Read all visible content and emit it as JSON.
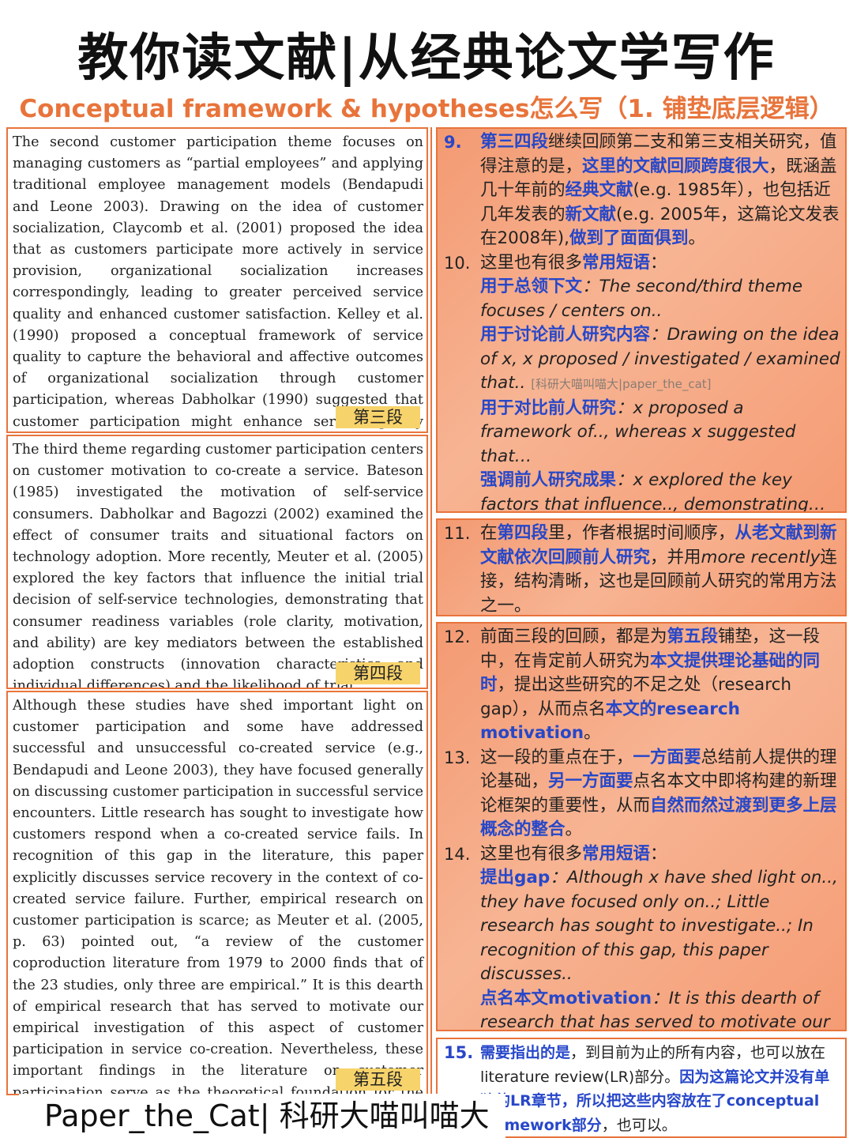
{
  "header": {
    "title": "教你读文献|从经典论文学写作",
    "subtitle": "Conceptual framework & hypotheses怎么写（1. 铺垫底层逻辑）"
  },
  "left": {
    "para3": {
      "text": "The second customer participation theme focuses on managing customers as “partial employees” and applying traditional employee management models (Bendapudi and Leone 2003). Drawing on the idea of customer socialization, Claycomb et al. (2001) proposed the idea that as customers participate more actively in service provision, organizational socialization increases correspondingly, leading to greater perceived service quality and enhanced customer satisfaction. Kelley et al. (1990) proposed a conceptual framework of service quality to capture the behavioral and affective outcomes of organizational socialization through customer participation, whereas Dabholkar (1990) suggested that customer participation might enhance service quality perceptions and satisfaction.",
      "tag": "第三段"
    },
    "para4": {
      "text": "The third theme regarding customer participation centers on customer motivation to co-create a service. Bateson (1985) investigated the motivation of self-service consumers. Dabholkar and Bagozzi (2002) examined the effect of consumer traits and situational factors on technology adoption. More recently, Meuter et al. (2005) explored the key factors that influence the initial trial decision of self-service technologies, demonstrating that consumer readiness variables (role clarity, motivation, and ability) are key mediators between the established adoption constructs (innovation characteristics and individual differences) and the likelihood of trial.",
      "tag": "第四段"
    },
    "para5": {
      "text": "Although these studies have shed important light on customer participation and some have addressed successful and unsuccessful co-created service (e.g., Bendapudi and Leone 2003), they have focused generally on discussing customer participation in successful service encounters. Little research has sought to investigate how customers respond when a co-created service fails. In recognition of this gap in the literature, this paper explicitly discusses service recovery in the context of co-created service failure. Further, empirical research on customer participation is scarce; as Meuter et al. (2005, p. 63) pointed out, “a review of the customer coproduction literature from 1979 to 2000 finds that of the 23 studies, only three are empirical.” It is this dearth of empirical research that has served to motivate our empirical investigation of this aspect of customer participation in service co-creation. Nevertheless, these important findings in the literature on customer participation serve as the theoretical foundation for the framework proposed in this study.",
      "tag": "第五段"
    }
  },
  "right": {
    "box1": {
      "n9": "9.",
      "s9a": "第三四段",
      "s9b": "继续回顾第二支和第三支相关研究，值得注意的是，",
      "s9c": "这里的文献回顾跨度很大",
      "s9d": "，既涵盖几十年前的",
      "s9e": "经典文献",
      "s9f": "(e.g. 1985年），也包括近几年发表的",
      "s9g": "新文献",
      "s9h": "(e.g. 2005年，这篇论文发表在2008年),",
      "s9i": "做到了面面俱到",
      "s9j": "。",
      "n10": "10.",
      "s10a": "这里也有很多",
      "s10b": "常用短语",
      "s10c": "：",
      "p1k": "用于总领下文",
      "p1v": "：The second/third theme focuses / centers on..",
      "p2k": "用于讨论前人研究内容",
      "p2v": "：Drawing on the idea of x, x proposed / investigated / examined that..",
      "wm": "[科研大喵叫喵大|paper_the_cat]",
      "p3k": "用于对比前人研究",
      "p3v": "：x proposed a framework of.., whereas x suggested that…",
      "p4k": "强调前人研究成果",
      "p4v": "：x explored the key factors that influence.., demonstrating…"
    },
    "box2": {
      "n11": "11.",
      "a": "在",
      "b": "第四段",
      "c": "里，作者根据时间顺序，",
      "d": "从老文献到新文献依次回顾前人研究",
      "e": "，并用",
      "f": "more recently",
      "g": "连接，结构清晰，这也是回顾前人研究的常用方法之一。"
    },
    "box3": {
      "n12": "12.",
      "a": "前面三段的回顾，都是为",
      "b": "第五段",
      "c": "铺垫，这一段中，在肯定前人研究为",
      "d": "本文提供理论基础的同时",
      "e": "，提出这些研究的不足之处（research gap），从而点名",
      "f": "本文的research motivation",
      "g": "。",
      "n13": "13.",
      "h": "这一段的重点在于，",
      "i": "一方面要",
      "j": "总结前人提供的理论基础，",
      "k": "另一方面要",
      "l": "点名本文中即将构建的新理论框架的重要性，从而",
      "m": "自然而然过渡到更多上层概念的整合",
      "o": "。",
      "n14": "14.",
      "p": "这里也有很多",
      "q": "常用短语",
      "r": "：",
      "k1": "提出gap",
      "v1": "：Although x have shed light on.., they have focused only on..; Little research has sought to investigate..; In recognition of this gap, this paper discusses..",
      "k2": "点名本文motivation",
      "v2": "：It is this dearth of research that has served to motivate our investigation of.."
    },
    "box4": {
      "n15": "15.",
      "a": "需要指出的是",
      "b": "，到目前为止的所有内容，也可以放在literature review(LR)部分。",
      "c": "因为这篇论文并没有单独的LR章节，所以把这些内容放在了conceptual framework部分",
      "d": "，也可以。"
    }
  },
  "footer": {
    "brand": "Paper_the_Cat| 科研大喵叫喵大"
  },
  "colors": {
    "accent": "#e8743b",
    "highlight_blue": "#2747c9",
    "tag_yellow": "#f7d36b"
  }
}
